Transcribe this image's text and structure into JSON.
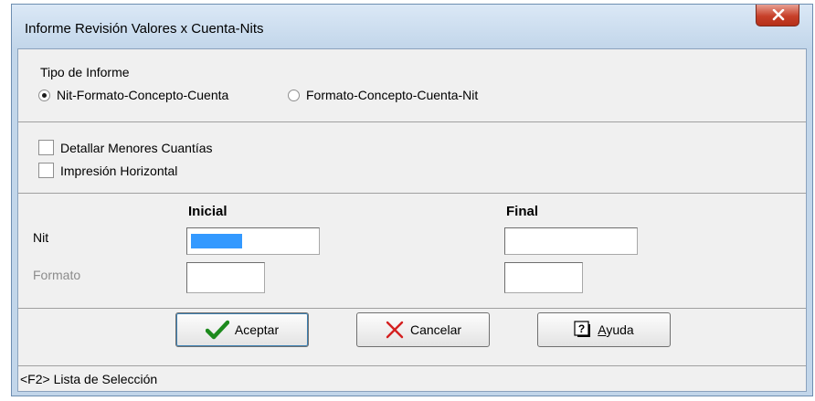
{
  "window": {
    "title": "Informe Revisión Valores x Cuenta-Nits"
  },
  "tipo_informe": {
    "label": "Tipo de Informe",
    "options": [
      {
        "label": "Nit-Formato-Concepto-Cuenta",
        "selected": true
      },
      {
        "label": "Formato-Concepto-Cuenta-Nit",
        "selected": false
      }
    ]
  },
  "options": {
    "detallar": {
      "label": "Detallar Menores Cuantías",
      "checked": false
    },
    "horizontal": {
      "label": "Impresión Horizontal",
      "checked": false
    }
  },
  "ranges": {
    "inicial_header": "Inicial",
    "final_header": "Final",
    "nit": {
      "label": "Nit",
      "inicial": "",
      "final": ""
    },
    "formato": {
      "label": "Formato",
      "inicial": "",
      "final": ""
    }
  },
  "buttons": {
    "aceptar": "Aceptar",
    "cancelar": "Cancelar",
    "ayuda_first": "A",
    "ayuda_rest": "yuda"
  },
  "status": {
    "text": "<F2> Lista de Selección"
  },
  "colors": {
    "accent": "#3399ff",
    "disabled_text": "#8c8c8c",
    "check_green": "#1d8a1d",
    "cancel_red": "#d42020"
  }
}
